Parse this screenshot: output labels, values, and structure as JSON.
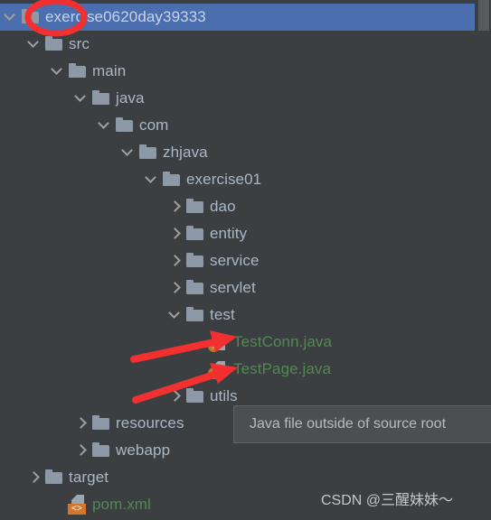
{
  "window": {
    "background_color": "#3c3f41",
    "selection_color": "#4b6eaf",
    "label_color": "#a9b7c6",
    "file_green": "#4f8a4f",
    "annotation_color": "#f23030"
  },
  "tree": {
    "name": "project-tree",
    "rows": [
      {
        "label": "exercise0620day39333",
        "icon": "folder-icon",
        "state": "expanded",
        "depth": 0,
        "selected": true,
        "color": "default"
      },
      {
        "label": "src",
        "icon": "folder-icon",
        "state": "expanded",
        "depth": 1,
        "selected": false,
        "color": "default"
      },
      {
        "label": "main",
        "icon": "folder-icon",
        "state": "expanded",
        "depth": 2,
        "selected": false,
        "color": "default"
      },
      {
        "label": "java",
        "icon": "folder-icon",
        "state": "expanded",
        "depth": 3,
        "selected": false,
        "color": "default"
      },
      {
        "label": "com",
        "icon": "folder-icon",
        "state": "expanded",
        "depth": 4,
        "selected": false,
        "color": "default"
      },
      {
        "label": "zhjava",
        "icon": "folder-icon",
        "state": "expanded",
        "depth": 5,
        "selected": false,
        "color": "default"
      },
      {
        "label": "exercise01",
        "icon": "folder-icon",
        "state": "expanded",
        "depth": 6,
        "selected": false,
        "color": "default"
      },
      {
        "label": "dao",
        "icon": "folder-icon",
        "state": "collapsed",
        "depth": 7,
        "selected": false,
        "color": "default"
      },
      {
        "label": "entity",
        "icon": "folder-icon",
        "state": "collapsed",
        "depth": 7,
        "selected": false,
        "color": "default"
      },
      {
        "label": "service",
        "icon": "folder-icon",
        "state": "collapsed",
        "depth": 7,
        "selected": false,
        "color": "default"
      },
      {
        "label": "servlet",
        "icon": "folder-icon",
        "state": "collapsed",
        "depth": 7,
        "selected": false,
        "color": "default"
      },
      {
        "label": "test",
        "icon": "folder-icon",
        "state": "expanded",
        "depth": 7,
        "selected": false,
        "color": "default"
      },
      {
        "label": "TestConn.java",
        "icon": "java-file-icon",
        "state": "leaf",
        "depth": 8,
        "selected": false,
        "color": "green"
      },
      {
        "label": "TestPage.java",
        "icon": "java-file-icon",
        "state": "leaf",
        "depth": 8,
        "selected": false,
        "color": "green"
      },
      {
        "label": "utils",
        "icon": "folder-icon",
        "state": "collapsed",
        "depth": 7,
        "selected": false,
        "color": "default"
      },
      {
        "label": "resources",
        "icon": "folder-icon",
        "state": "collapsed",
        "depth": 3,
        "selected": false,
        "color": "default"
      },
      {
        "label": "webapp",
        "icon": "folder-icon",
        "state": "collapsed",
        "depth": 3,
        "selected": false,
        "color": "default"
      },
      {
        "label": "target",
        "icon": "folder-icon",
        "state": "collapsed",
        "depth": 1,
        "selected": false,
        "color": "default"
      },
      {
        "label": "pom.xml",
        "icon": "xml-file-icon",
        "state": "leaf",
        "depth": 2,
        "selected": false,
        "color": "green"
      }
    ],
    "java_badge_letter": "J",
    "xml_badge_glyph": "<>"
  },
  "tooltip": {
    "name": "java-file-outside-source-root-tooltip",
    "text": "Java file outside of source root"
  },
  "watermark": {
    "text": "CSDN @三醒妹妹～"
  },
  "annotations": {
    "ellipse": {
      "name": "red-ellipse-highlight",
      "target": "root-folder-icon"
    },
    "arrows": [
      {
        "name": "red-arrow-testconn",
        "target": "TestConn.java badge"
      },
      {
        "name": "red-arrow-testpage",
        "target": "TestPage.java badge"
      }
    ]
  },
  "scrollbar": {
    "name": "vertical-scrollbar",
    "position": "top"
  }
}
